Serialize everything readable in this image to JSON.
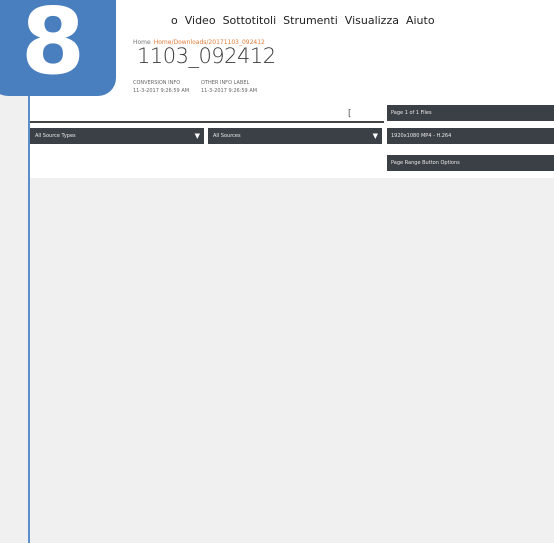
{
  "menu": {
    "items": [
      "o",
      "Video",
      "Sottotitoli",
      "Strumenti",
      "Visualizza",
      "Aiuto"
    ]
  },
  "header": {
    "breadcrumb_prefix": "Home",
    "breadcrumb_link": "Home/Downloads/20171103_092412",
    "title": "1103_092412",
    "meta_col1": [
      "CONVERSION INFO",
      "11-3-2017 9:26:59 AM"
    ],
    "meta_col2": [
      "OTHER INFO LABEL",
      "11-3-2017 9:26:59 AM"
    ]
  },
  "filters": {
    "search_glyph": "[",
    "source_types": "All Source Types",
    "sources": "All Sources"
  },
  "right_panel": {
    "item1": "Page 1 of 1 Files",
    "item2": "1920x1080 MP4 - H.264",
    "item3": "Page Range Button Options"
  },
  "badge": {
    "number": "8"
  },
  "colors": {
    "accent": "#4a7fbf",
    "dark_control": "#3b4046",
    "link": "#e07b39"
  }
}
